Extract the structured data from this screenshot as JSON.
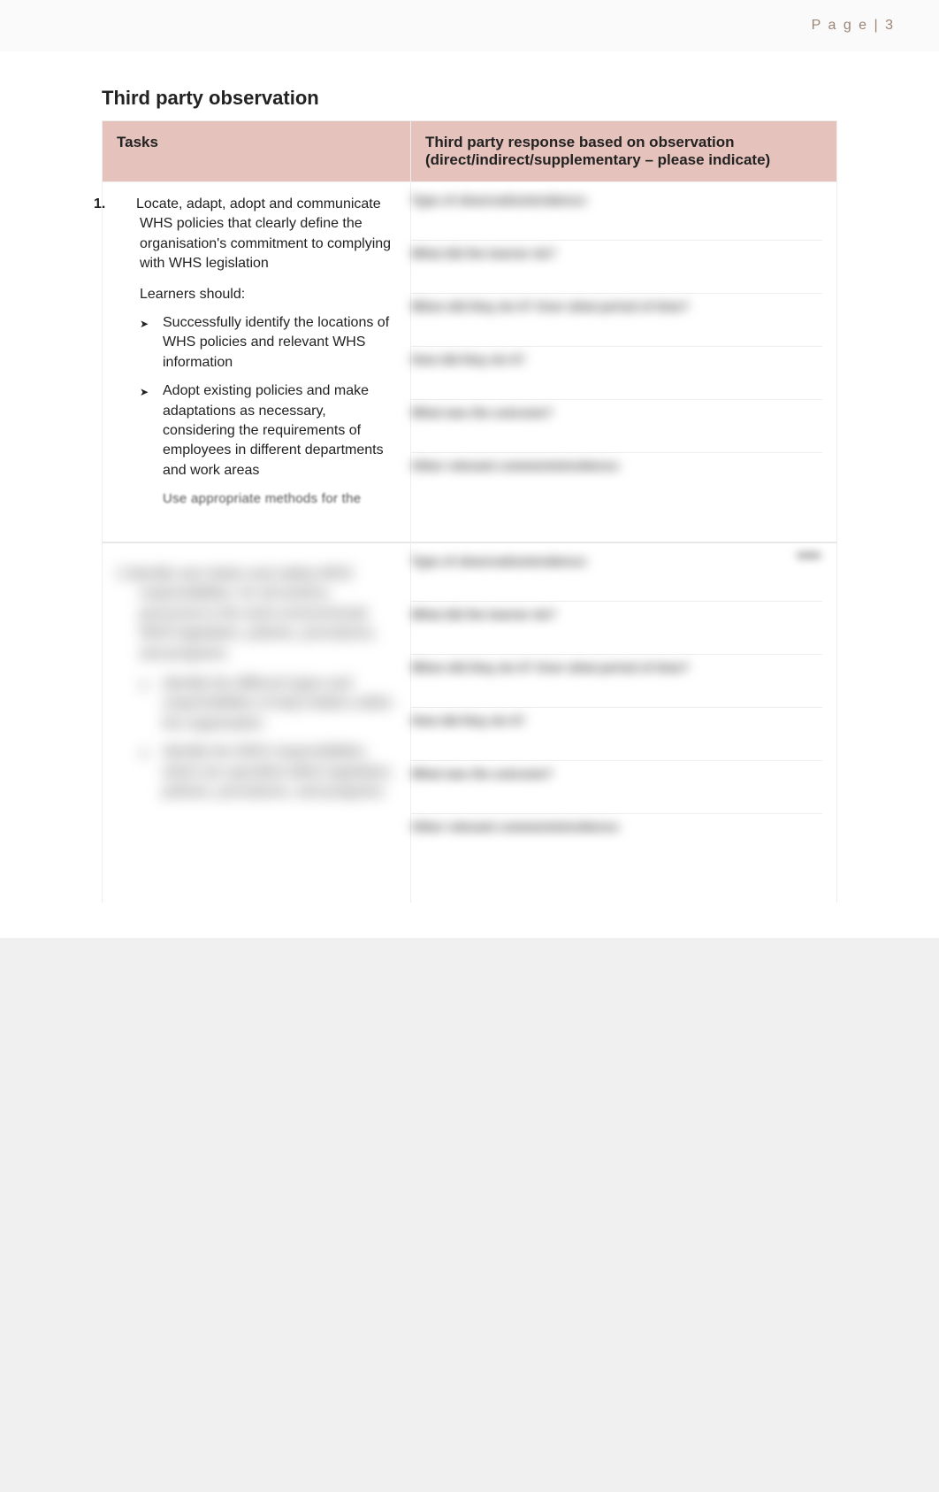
{
  "page_number_label": "P a g e | 3",
  "section_title": "Third party observation",
  "columns": {
    "tasks": "Tasks",
    "response": "Third party response based on observation (direct/indirect/supplementary – please indicate)"
  },
  "tasks": [
    {
      "number": "1.",
      "main": "Locate, adapt, adopt and communicate WHS policies that clearly define the organisation's commitment to complying with WHS legislation",
      "learners_should": "Learners should:",
      "bullets": [
        "Successfully identify the locations of WHS policies and relevant WHS information",
        "Adopt existing policies and make adaptations as necessary, considering the requirements of employees in different departments and work areas"
      ],
      "cutoff_partial": "Use appropriate methods for the"
    }
  ],
  "response_prompts": {
    "type": "Type of observation/evidence:",
    "what": "What did the learner do?",
    "when": "When did they do it? Over what period of time?",
    "how": "How did they do it?",
    "outcome": "What was the outcome?",
    "other": "Other relevant comments/evidence:"
  },
  "task2_blurred": {
    "main": "Identify own duties and safety-WHS responsibilities, for all workers, personnel in the work environmental WHS legislation, policies, procedures, and programs",
    "bullets": [
      "Identify the different types and responsibilities of duty holders within the organization",
      "Identify the WHS responsibilities which are specified within legislation, policies, procedures, and programs"
    ]
  }
}
